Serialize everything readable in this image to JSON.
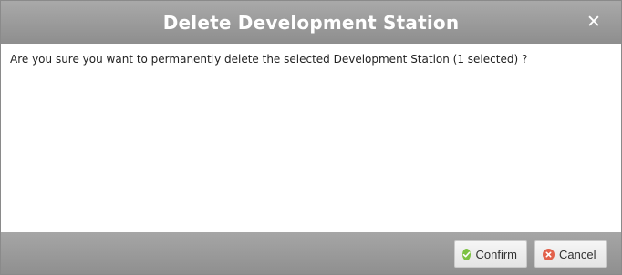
{
  "dialog": {
    "title": "Delete Development Station",
    "close_icon": "close-icon",
    "message": "Are you sure you want to permanently delete the selected Development Station (1 selected) ?"
  },
  "buttons": {
    "confirm_label": "Confirm",
    "confirm_icon": "check-circle-icon",
    "cancel_label": "Cancel",
    "cancel_icon": "x-circle-icon"
  },
  "colors": {
    "titlebar": "#9c9c9c",
    "confirm_icon": "#7cc242",
    "cancel_icon": "#e2614b"
  }
}
